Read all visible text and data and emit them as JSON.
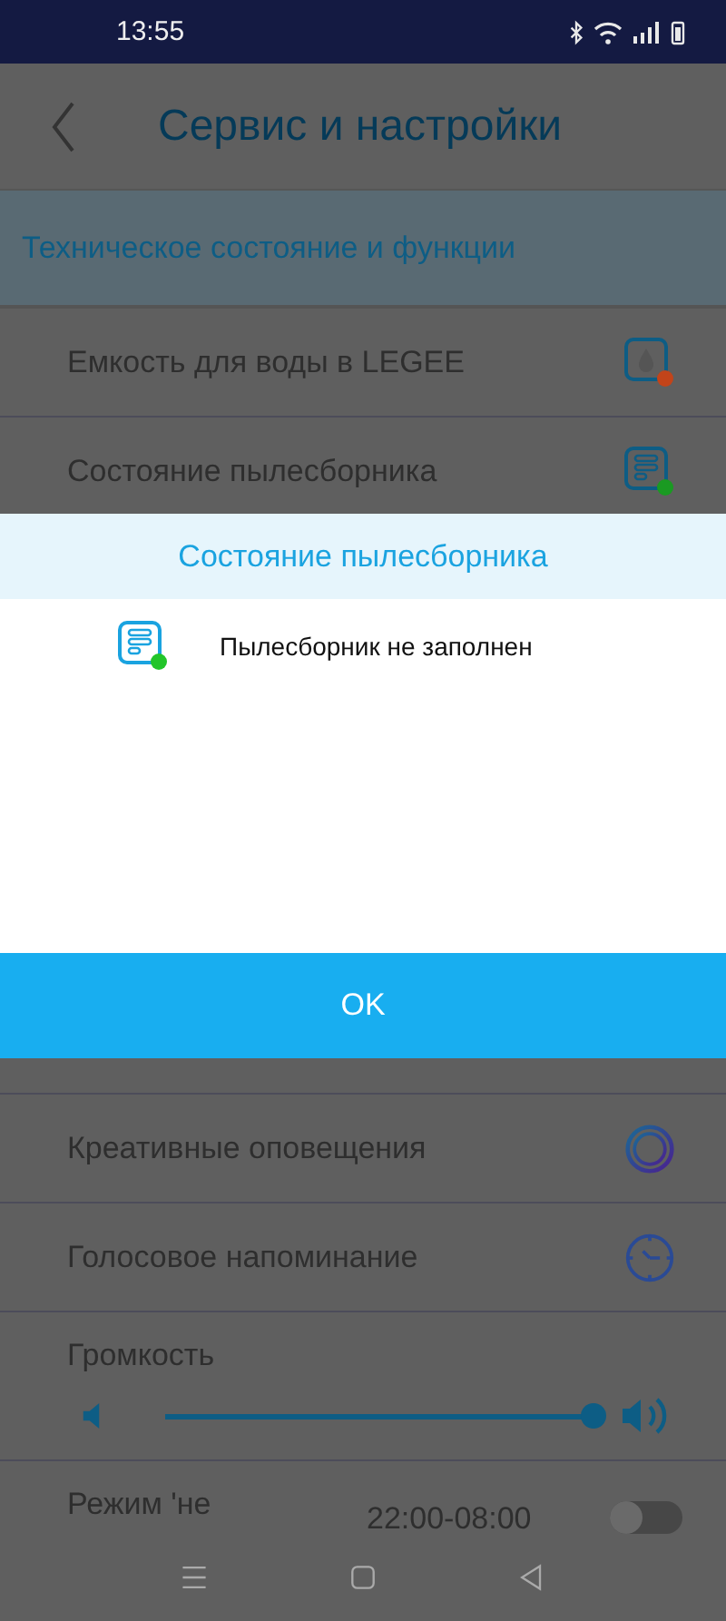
{
  "status_bar": {
    "time": "13:55"
  },
  "header": {
    "title": "Сервис и настройки"
  },
  "section": {
    "title": "Техническое состояние и функции"
  },
  "rows_top": [
    {
      "label": "Емкость для воды в LEGEE",
      "kind": "water",
      "color": "#c2441a"
    },
    {
      "label": "Состояние пылесборника",
      "kind": "dust",
      "color": "#1a9a22"
    }
  ],
  "rows_bottom": [
    {
      "label": "Креативные оповещения",
      "kind": "ring"
    },
    {
      "label": "Голосовое напоминание",
      "kind": "clock"
    }
  ],
  "volume": {
    "label": "Громкость",
    "level": 1
  },
  "dnd": {
    "label": "Режим 'не",
    "time": "22:00-08:00",
    "on": false
  },
  "dialog": {
    "title": "Состояние пылесборника",
    "message": "Пылесборник не заполнен",
    "kind": "dust",
    "color": "#22c52a",
    "button": "OK"
  }
}
